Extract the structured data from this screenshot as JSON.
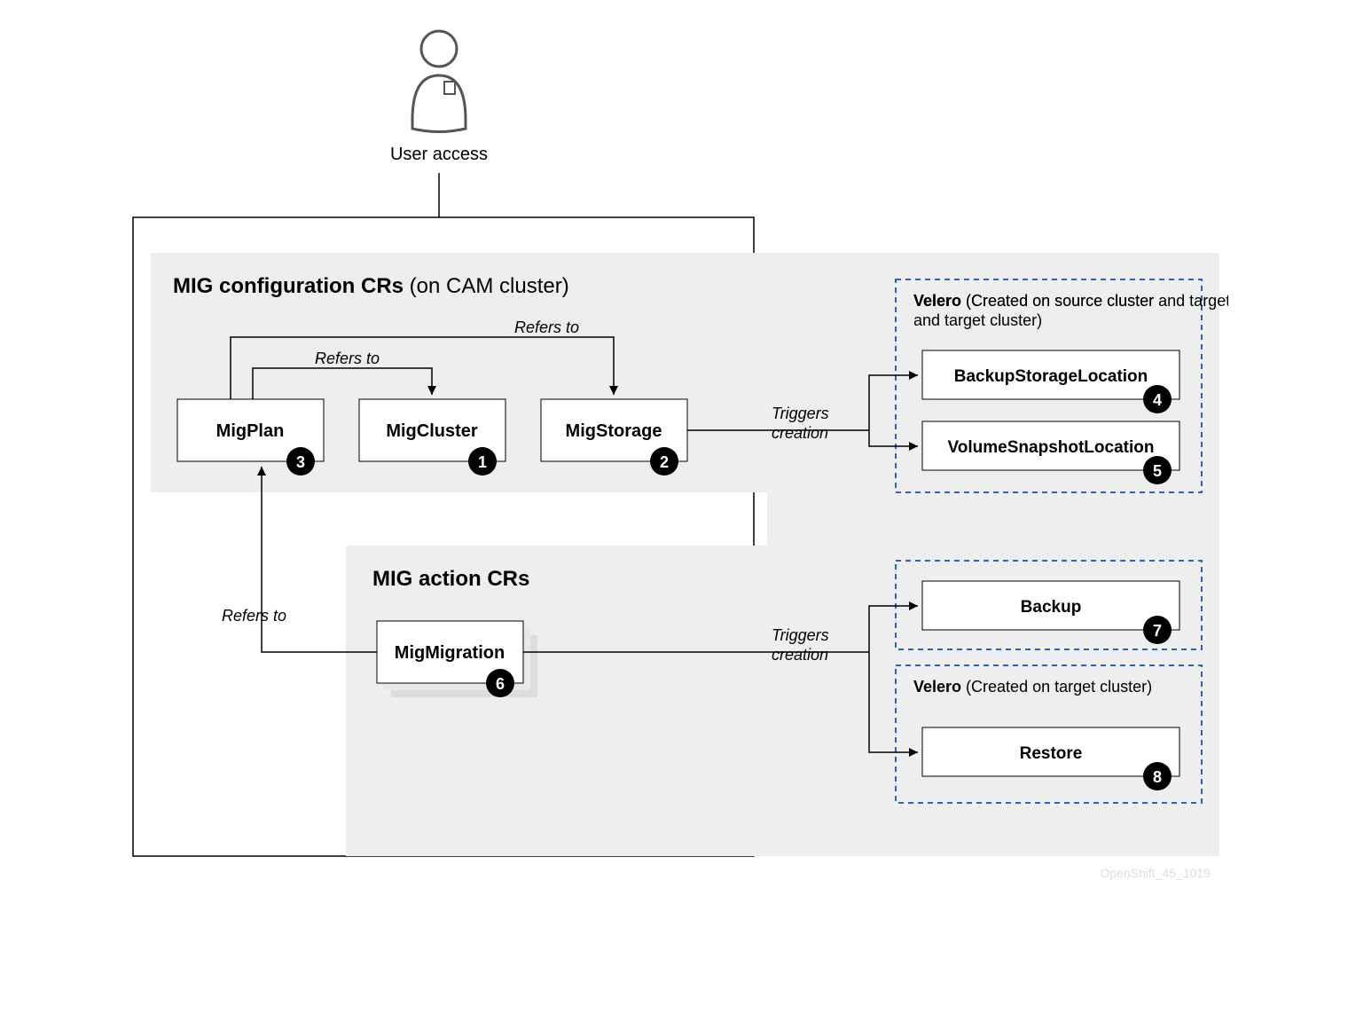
{
  "user_label": "User access",
  "config_section": {
    "title_bold": "MIG configuration CRs",
    "title_rest": " (on CAM cluster)"
  },
  "action_section": {
    "title_bold": "MIG action CRs"
  },
  "boxes": {
    "migplan": {
      "label": "MigPlan",
      "num": "3"
    },
    "migcluster": {
      "label": "MigCluster",
      "num": "1"
    },
    "migstorage": {
      "label": "MigStorage",
      "num": "2"
    },
    "migmigration": {
      "label": "MigMigration",
      "num": "6"
    },
    "backupstorage": {
      "label": "BackupStorageLocation",
      "num": "4"
    },
    "volsnapshot": {
      "label": "VolumeSnapshotLocation",
      "num": "5"
    },
    "backup": {
      "label": "Backup",
      "num": "7"
    },
    "restore": {
      "label": "Restore",
      "num": "8"
    }
  },
  "velero1": {
    "bold": "Velero",
    "rest": " (Created on source cluster and target cluster)"
  },
  "velero3": {
    "bold": "Velero",
    "rest": " (Created on target cluster)"
  },
  "edges": {
    "refers1": "Refers to",
    "refers2": "Refers to",
    "refers3": "Refers to",
    "trig1a": "Triggers",
    "trig1b": "creation",
    "trig2a": "Triggers",
    "trig2b": "creation"
  },
  "footer": "OpenShift_45_1019"
}
